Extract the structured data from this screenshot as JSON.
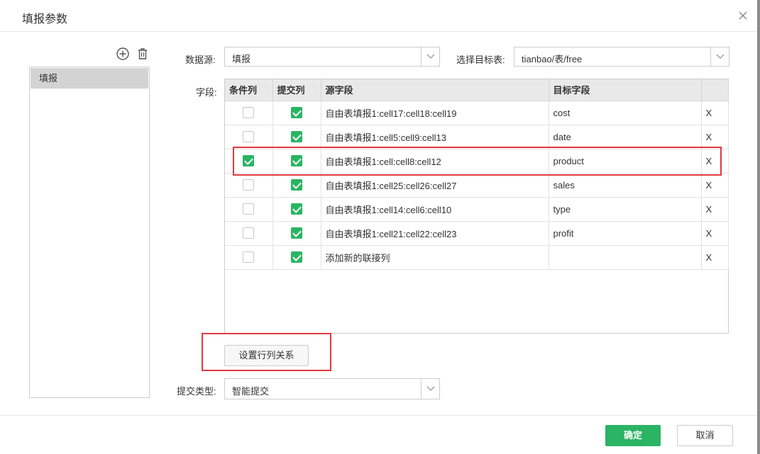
{
  "dialog": {
    "title": "填报参数",
    "close_icon": "close-icon"
  },
  "left": {
    "add_icon": "add-circle-icon",
    "delete_icon": "trash-icon",
    "items": [
      {
        "label": "填报"
      }
    ]
  },
  "form": {
    "datasource_label": "数据源:",
    "datasource_value": "填报",
    "target_label": "选择目标表:",
    "target_value": "tianbao/表/free",
    "fields_label": "字段:",
    "submit_type_label": "提交类型:",
    "submit_type_value": "智能提交"
  },
  "table": {
    "headers": [
      "条件列",
      "提交列",
      "源字段",
      "目标字段",
      ""
    ],
    "rows": [
      {
        "condition": false,
        "submit": true,
        "source": "自由表填报1:cell17:cell18:cell19",
        "target": "cost",
        "remove": "X"
      },
      {
        "condition": false,
        "submit": true,
        "source": "自由表填报1:cell5:cell9:cell13",
        "target": "date",
        "remove": "X"
      },
      {
        "condition": true,
        "submit": true,
        "source": "自由表填报1:cell:cell8:cell12",
        "target": "product",
        "remove": "X"
      },
      {
        "condition": false,
        "submit": true,
        "source": "自由表填报1:cell25:cell26:cell27",
        "target": "sales",
        "remove": "X"
      },
      {
        "condition": false,
        "submit": true,
        "source": "自由表填报1:cell14:cell6:cell10",
        "target": "type",
        "remove": "X"
      },
      {
        "condition": false,
        "submit": true,
        "source": "自由表填报1:cell21:cell22:cell23",
        "target": "profit",
        "remove": "X"
      },
      {
        "condition": false,
        "submit": true,
        "source": "添加新的联接列",
        "target": "",
        "remove": "X"
      }
    ]
  },
  "buttons": {
    "set_relation": "设置行列关系",
    "ok": "确定",
    "cancel": "取消"
  },
  "colors": {
    "accent": "#2ab464",
    "highlight": "#e0393e"
  }
}
